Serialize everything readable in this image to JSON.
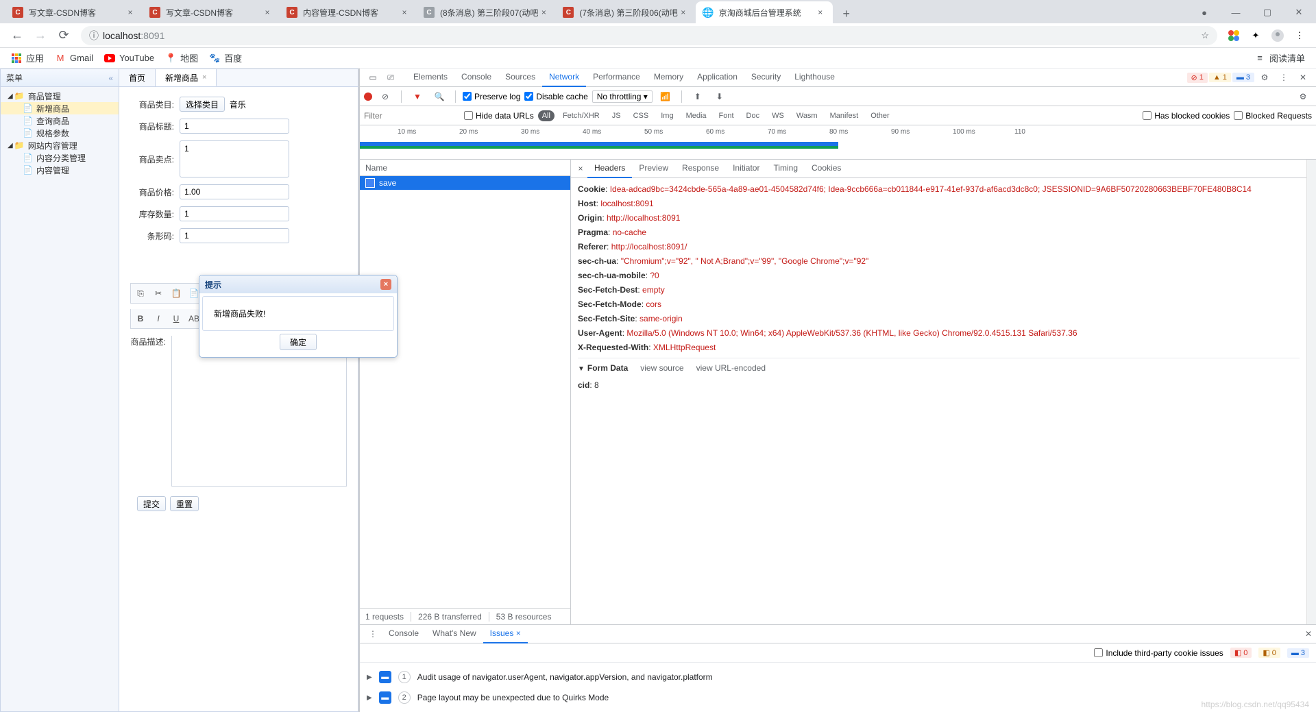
{
  "browser": {
    "tabs": [
      {
        "title": "写文章-CSDN博客",
        "icon": "C"
      },
      {
        "title": "写文章-CSDN博客",
        "icon": "C"
      },
      {
        "title": "内容管理-CSDN博客",
        "icon": "C"
      },
      {
        "title": "(8条消息) 第三阶段07(动吧",
        "icon": "C"
      },
      {
        "title": "(7条消息) 第三阶段06(动吧",
        "icon": "C"
      },
      {
        "title": "京淘商城后台管理系统",
        "icon": "globe",
        "active": true
      }
    ],
    "url_prefix": "localhost",
    "url_suffix": ":8091",
    "reading_list": "阅读清单",
    "bookmarks": [
      {
        "label": "应用",
        "icon": "apps"
      },
      {
        "label": "Gmail",
        "icon": "gmail"
      },
      {
        "label": "YouTube",
        "icon": "youtube"
      },
      {
        "label": "地图",
        "icon": "maps"
      },
      {
        "label": "百度",
        "icon": "baidu"
      }
    ]
  },
  "sidebar": {
    "title": "菜单",
    "tree": [
      {
        "label": "商品管理",
        "type": "folder",
        "children": [
          {
            "label": "新增商品",
            "selected": true
          },
          {
            "label": "查询商品"
          },
          {
            "label": "规格参数"
          }
        ]
      },
      {
        "label": "网站内容管理",
        "type": "folder",
        "children": [
          {
            "label": "内容分类管理"
          },
          {
            "label": "内容管理"
          }
        ]
      }
    ]
  },
  "maintabs": [
    {
      "label": "首页"
    },
    {
      "label": "新增商品",
      "active": true
    }
  ],
  "form": {
    "category": {
      "label": "商品类目:",
      "button": "选择类目",
      "value": "音乐"
    },
    "title": {
      "label": "商品标题:",
      "value": "1"
    },
    "sellpoint": {
      "label": "商品卖点:",
      "value": "1"
    },
    "price": {
      "label": "商品价格:",
      "value": "1.00"
    },
    "stock": {
      "label": "库存数量:",
      "value": "1"
    },
    "barcode": {
      "label": "条形码:",
      "value": "1"
    },
    "desc": {
      "label": "商品描述:"
    },
    "submit": "提交",
    "reset": "重置"
  },
  "dialog": {
    "title": "提示",
    "message": "新增商品失败!",
    "ok": "确定"
  },
  "devtools": {
    "tabs": [
      "Elements",
      "Console",
      "Sources",
      "Network",
      "Performance",
      "Memory",
      "Application",
      "Security",
      "Lighthouse"
    ],
    "active_tab": "Network",
    "status": {
      "errors": "1",
      "warnings": "1",
      "info": "3"
    },
    "preserve_log": "Preserve log",
    "disable_cache": "Disable cache",
    "throttling": "No throttling",
    "filter_placeholder": "Filter",
    "hide_data_urls": "Hide data URLs",
    "filter_tags": [
      "All",
      "Fetch/XHR",
      "JS",
      "CSS",
      "Img",
      "Media",
      "Font",
      "Doc",
      "WS",
      "Wasm",
      "Manifest",
      "Other"
    ],
    "filter_active": "All",
    "has_blocked_cookies": "Has blocked cookies",
    "blocked_requests": "Blocked Requests",
    "timeline_ticks": [
      "10 ms",
      "20 ms",
      "30 ms",
      "40 ms",
      "50 ms",
      "60 ms",
      "70 ms",
      "80 ms",
      "90 ms",
      "100 ms",
      "110"
    ],
    "name_col": "Name",
    "requests": [
      {
        "name": "save"
      }
    ],
    "footer": {
      "requests": "1 requests",
      "transferred": "226 B transferred",
      "resources": "53 B resources"
    },
    "detail_tabs": [
      "Headers",
      "Preview",
      "Response",
      "Initiator",
      "Timing",
      "Cookies"
    ],
    "detail_active": "Headers",
    "headers": [
      {
        "k": "Cookie",
        "v": "Idea-adcad9bc=3424cbde-565a-4a89-ae01-4504582d74f6; Idea-9ccb666a=cb011844-e917-41ef-937d-af6acd3dc8c0; JSESSIONID=9A6BF50720280663BEBF70FE480B8C14"
      },
      {
        "k": "Host",
        "v": "localhost:8091"
      },
      {
        "k": "Origin",
        "v": "http://localhost:8091"
      },
      {
        "k": "Pragma",
        "v": "no-cache"
      },
      {
        "k": "Referer",
        "v": "http://localhost:8091/"
      },
      {
        "k": "sec-ch-ua",
        "v": "\"Chromium\";v=\"92\", \" Not A;Brand\";v=\"99\", \"Google Chrome\";v=\"92\""
      },
      {
        "k": "sec-ch-ua-mobile",
        "v": "?0"
      },
      {
        "k": "Sec-Fetch-Dest",
        "v": "empty"
      },
      {
        "k": "Sec-Fetch-Mode",
        "v": "cors"
      },
      {
        "k": "Sec-Fetch-Site",
        "v": "same-origin"
      },
      {
        "k": "User-Agent",
        "v": "Mozilla/5.0 (Windows NT 10.0; Win64; x64) AppleWebKit/537.36 (KHTML, like Gecko) Chrome/92.0.4515.131 Safari/537.36"
      },
      {
        "k": "X-Requested-With",
        "v": "XMLHttpRequest"
      }
    ],
    "form_data_label": "Form Data",
    "view_source": "view source",
    "view_url_encoded": "view URL-encoded",
    "form_data": [
      {
        "k": "cid",
        "v": "8"
      }
    ],
    "drawer_tabs": [
      "Console",
      "What's New",
      "Issues"
    ],
    "drawer_active": "Issues",
    "include_third_party": "Include third-party cookie issues",
    "drawer_badges": {
      "err": "0",
      "warn": "0",
      "info": "3"
    },
    "issues": [
      {
        "n": "1",
        "text": "Audit usage of navigator.userAgent, navigator.appVersion, and navigator.platform"
      },
      {
        "n": "2",
        "text": "Page layout may be unexpected due to Quirks Mode"
      }
    ]
  },
  "watermark": "https://blog.csdn.net/qq95434"
}
